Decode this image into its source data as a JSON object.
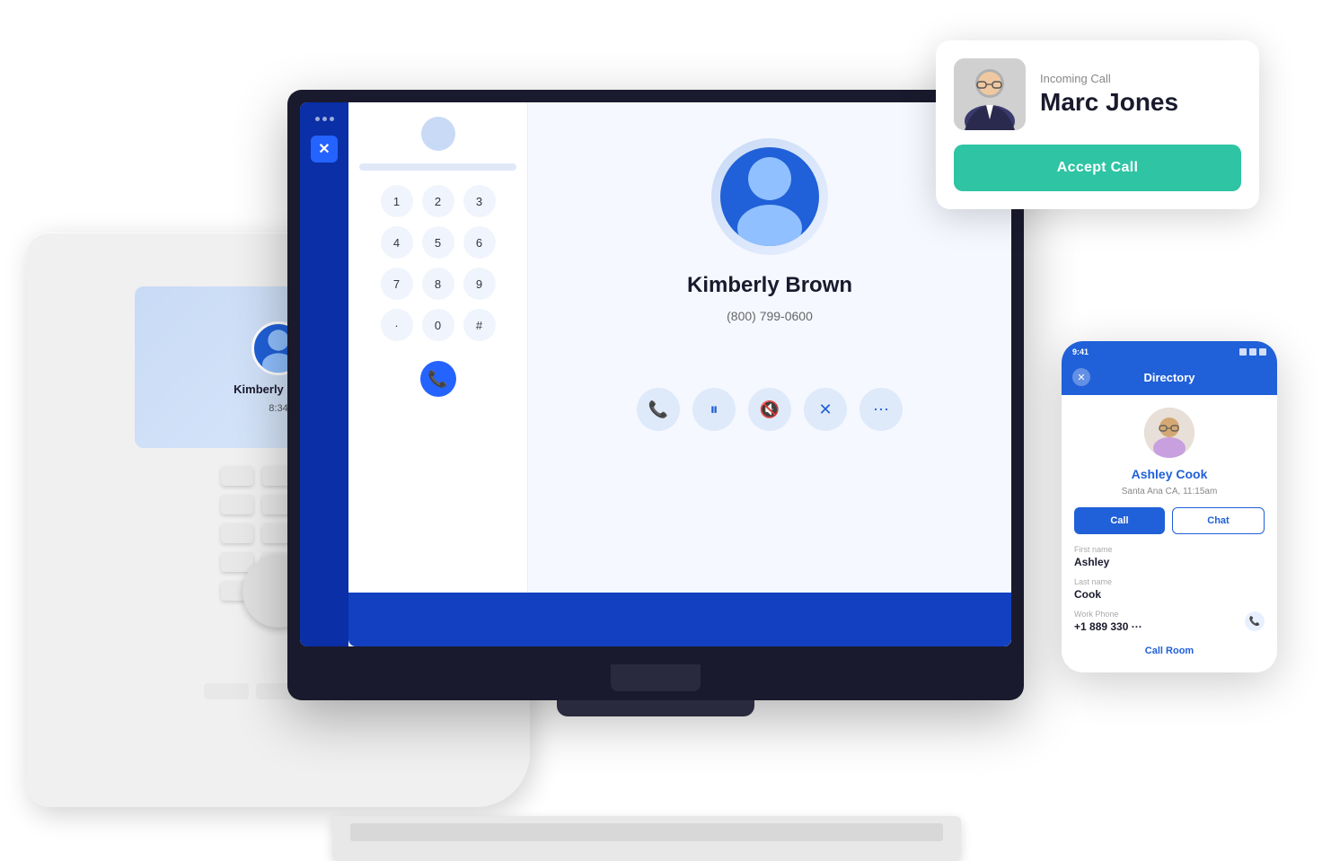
{
  "scene": {
    "bg_color": "#ffffff"
  },
  "incoming_call": {
    "label": "Incoming Call",
    "caller_name": "Marc Jones",
    "accept_button": "Accept Call"
  },
  "desktop_app": {
    "contact_name": "Kimberly Brown",
    "contact_phone": "(800) 799-0600",
    "keypad": [
      "1",
      "2",
      "3",
      "4",
      "5",
      "6",
      "7",
      "8",
      "9",
      "·",
      "0",
      "#"
    ]
  },
  "desk_phone": {
    "screen_name": "Kimberly Brown",
    "screen_time": "8:34"
  },
  "mobile_directory": {
    "title": "Directory",
    "contact_name": "Ashley Cook",
    "contact_location": "Santa Ana CA, 11:15am",
    "call_button": "Call",
    "chat_button": "Chat",
    "first_name_label": "First name",
    "first_name": "Ashley",
    "last_name_label": "Last name",
    "last_name": "Cook",
    "work_phone_label": "Work Phone",
    "work_phone": "+1 889 330 ···",
    "call_room_button": "Call Room",
    "status_time": "9:41"
  }
}
